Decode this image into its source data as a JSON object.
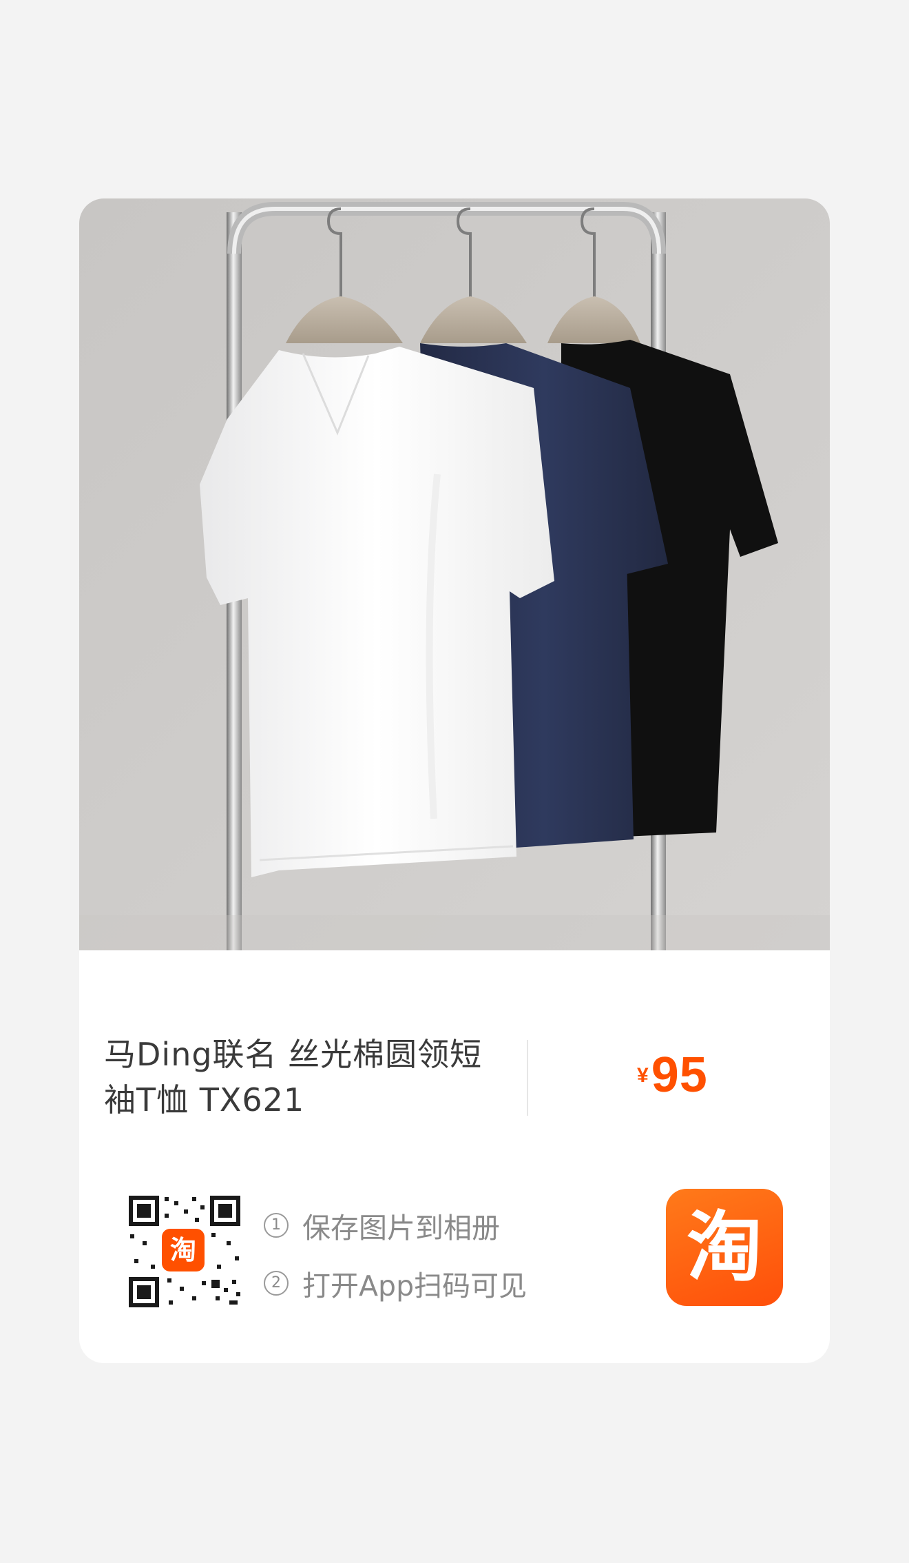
{
  "product": {
    "title_line1": "马Ding联名 丝光棉圆领短",
    "title_line2": "袖T恤 TX621",
    "currency_symbol": "¥",
    "price": "95"
  },
  "share": {
    "qr_logo_char": "淘",
    "steps": [
      {
        "num": "1",
        "text": "保存图片到相册"
      },
      {
        "num": "2",
        "text": "打开App扫码可见"
      }
    ],
    "app_badge_char": "淘"
  },
  "colors": {
    "accent": "#ff5000",
    "background": "#f3f3f3",
    "card": "#ffffff"
  },
  "icons": {
    "qr_code": "qr-code-icon",
    "taobao_logo": "taobao-logo-icon"
  }
}
